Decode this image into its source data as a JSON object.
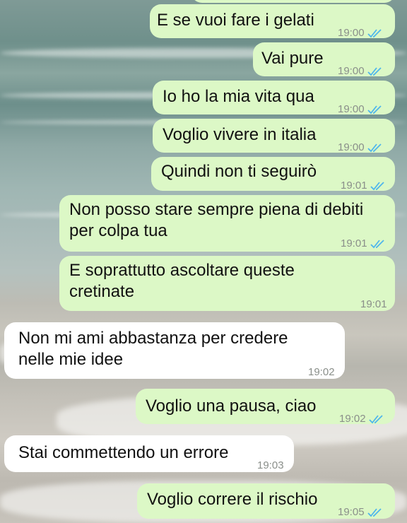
{
  "chat": {
    "messages": [
      {
        "dir": "out",
        "text": "E se vuoi fare i gelati",
        "time": "19:00",
        "read": true
      },
      {
        "dir": "out",
        "text": "Vai pure",
        "time": "19:00",
        "read": true
      },
      {
        "dir": "out",
        "text": "Io ho la mia vita qua",
        "time": "19:00",
        "read": true
      },
      {
        "dir": "out",
        "text": "Voglio vivere in italia",
        "time": "19:00",
        "read": true
      },
      {
        "dir": "out",
        "text": "Quindi non ti seguirò",
        "time": "19:01",
        "read": true
      },
      {
        "dir": "out",
        "lines": [
          "Non posso stare sempre piena di debiti",
          "per colpa tua"
        ],
        "time": "19:01",
        "read": true
      },
      {
        "dir": "out",
        "lines": [
          "E soprattutto ascoltare queste",
          "cretinate"
        ],
        "time": "19:01",
        "read": false
      },
      {
        "dir": "in",
        "lines": [
          "Non mi ami abbastanza per credere",
          "nelle mie idee"
        ],
        "time": "19:02"
      },
      {
        "dir": "out",
        "text": "Voglio una pausa, ciao",
        "time": "19:02",
        "read": true
      },
      {
        "dir": "in",
        "text": "Stai commettendo un errore",
        "time": "19:03"
      },
      {
        "dir": "out",
        "text": "Voglio correre il rischio",
        "time": "19:05",
        "read": true
      }
    ]
  },
  "colors": {
    "outgoing": "#dcf8c6",
    "incoming": "#ffffff",
    "tick": "#4fb6ec"
  },
  "icons": {
    "read_receipt": "double-check-icon"
  }
}
